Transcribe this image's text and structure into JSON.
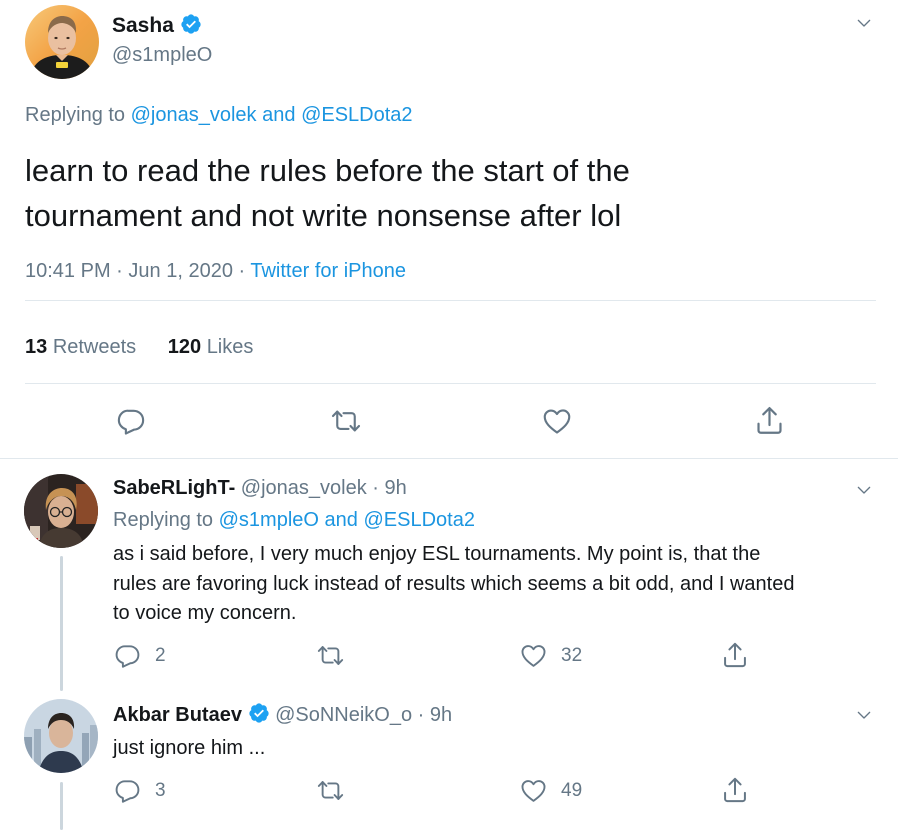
{
  "main_tweet": {
    "author_name": "Sasha",
    "handle": "@s1mpleO",
    "replying_prefix": "Replying to",
    "replying_to_1": "@jonas_volek",
    "replying_and": "and",
    "replying_to_2": "@ESLDota2",
    "text_line1": "learn to read the rules before the start of the",
    "text_line2": "tournament and not write nonsense after lol",
    "time": "10:41 PM",
    "date": "Jun 1, 2020",
    "source": "Twitter for iPhone",
    "separator": "·",
    "retweets_count": "13",
    "retweets_label": "Retweets",
    "likes_count": "120",
    "likes_label": "Likes"
  },
  "replies": [
    {
      "author_name": "SabeRLighT-",
      "handle": "@jonas_volek",
      "separator": "·",
      "age": "9h",
      "replying_prefix": "Replying to",
      "replying_to_1": "@s1mpleO",
      "replying_and": "and",
      "replying_to_2": "@ESLDota2",
      "text_line1": "as i said before, I very much enjoy ESL tournaments. My point is, that the",
      "text_line2": "rules are favoring luck instead of results which seems a bit odd, and I wanted",
      "text_line3": "to voice my concern.",
      "reply_count": "2",
      "like_count": "32"
    },
    {
      "author_name": "Akbar Butaev",
      "handle": "@SoNNeikO_o",
      "separator": "·",
      "age": "9h",
      "text_line1": "just ignore him ...",
      "reply_count": "3",
      "like_count": "49"
    }
  ],
  "colors": {
    "link": "#1b95e0",
    "muted": "#657786",
    "verified": "#1da1f2",
    "divider": "#e1e8ed"
  },
  "icons": [
    "verified-icon",
    "chevron-down-icon",
    "reply-icon",
    "retweet-icon",
    "like-icon",
    "share-icon"
  ]
}
